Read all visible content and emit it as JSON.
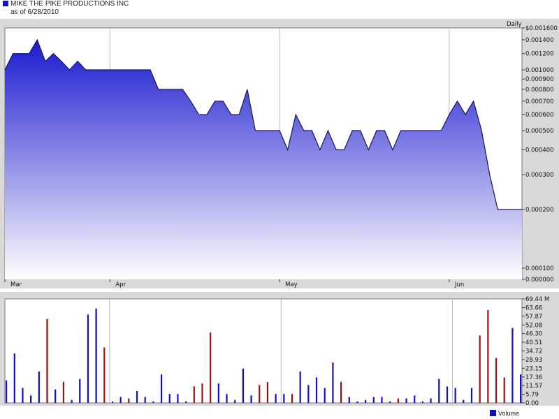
{
  "header": {
    "title": "MIKE THE PIKE PRODUCTIONS INC",
    "subtitle": "as of 6/28/2010"
  },
  "colors": {
    "accent": "#1010c8",
    "price_line": "#1a1a40",
    "fill_top": "#1a1ad0",
    "fill_bottom": "#ffffff",
    "up_bar": "#1010c8",
    "down_bar": "#a01010",
    "panel_bg": "#d9d9d9"
  },
  "chart_data": [
    {
      "type": "area",
      "period_label": "Daily",
      "y_scale": "log",
      "ylim": [
        0.0,
        0.0016
      ],
      "y_ticks": [
        {
          "value": 0.0016,
          "label": "$0.001600"
        },
        {
          "value": 0.0014,
          "label": "0.001400"
        },
        {
          "value": 0.0012,
          "label": "0.001200"
        },
        {
          "value": 0.001,
          "label": "0.001000"
        },
        {
          "value": 0.0009,
          "label": "0.000900"
        },
        {
          "value": 0.0008,
          "label": "0.000800"
        },
        {
          "value": 0.0007,
          "label": "0.000700"
        },
        {
          "value": 0.0006,
          "label": "0.000600"
        },
        {
          "value": 0.0005,
          "label": "0.000500"
        },
        {
          "value": 0.0004,
          "label": "0.000400"
        },
        {
          "value": 0.0003,
          "label": "0.000300"
        },
        {
          "value": 0.0002,
          "label": "0.000200"
        },
        {
          "value": 0.0001,
          "label": "0.000100"
        },
        {
          "value": 0.0,
          "label": "0.000000"
        }
      ],
      "x_labels": [
        "Mar",
        "Apr",
        "May",
        "Jun"
      ],
      "month_start_index": [
        0,
        13,
        34,
        55
      ],
      "values": [
        0.001,
        0.0012,
        0.0012,
        0.0012,
        0.0014,
        0.0011,
        0.0012,
        0.0011,
        0.001,
        0.0011,
        0.001,
        0.001,
        0.001,
        0.001,
        0.001,
        0.001,
        0.001,
        0.001,
        0.001,
        0.0008,
        0.0008,
        0.0008,
        0.0008,
        0.0007,
        0.0006,
        0.0006,
        0.0007,
        0.0007,
        0.0006,
        0.0006,
        0.0008,
        0.0005,
        0.0005,
        0.0005,
        0.0005,
        0.0004,
        0.0006,
        0.0005,
        0.0005,
        0.0004,
        0.0005,
        0.0004,
        0.0004,
        0.0005,
        0.0005,
        0.0004,
        0.0005,
        0.0005,
        0.0004,
        0.0005,
        0.0005,
        0.0005,
        0.0005,
        0.0005,
        0.0005,
        0.0006,
        0.0007,
        0.0006,
        0.0007,
        0.0005,
        0.0003,
        0.0002,
        0.0002,
        0.0002,
        0.0002
      ]
    },
    {
      "type": "bar",
      "series_name": "Volume",
      "unit": "M",
      "ylim": [
        0,
        69.44
      ],
      "y_tick_labels": [
        "69.44 M",
        "63.66",
        "57.87",
        "52.08",
        "46.30",
        "40.51",
        "34.72",
        "28.93",
        "23.15",
        "17.36",
        "11.57",
        "5.79",
        "0.00"
      ],
      "values": [
        15,
        33,
        10,
        5,
        21,
        56,
        9,
        14,
        2,
        16,
        59,
        63,
        37,
        1,
        4,
        3,
        8,
        4,
        1,
        19,
        6,
        6,
        1,
        11,
        13,
        47,
        13,
        6,
        2,
        23,
        5,
        12,
        14,
        6,
        6,
        6,
        21,
        12,
        17,
        10,
        27,
        14,
        4,
        1,
        2,
        4,
        4,
        1,
        3,
        3,
        5,
        1,
        3,
        16,
        11,
        10,
        2,
        10,
        45,
        62,
        30,
        17,
        50,
        19
      ],
      "up_down": [
        "u",
        "u",
        "u",
        "u",
        "u",
        "d",
        "u",
        "d",
        "u",
        "u",
        "u",
        "u",
        "d",
        "u",
        "u",
        "d",
        "u",
        "u",
        "u",
        "u",
        "u",
        "u",
        "u",
        "d",
        "d",
        "d",
        "u",
        "u",
        "u",
        "u",
        "u",
        "d",
        "d",
        "u",
        "u",
        "d",
        "u",
        "u",
        "u",
        "u",
        "u",
        "d",
        "u",
        "u",
        "u",
        "u",
        "u",
        "u",
        "d",
        "u",
        "u",
        "u",
        "u",
        "u",
        "u",
        "u",
        "u",
        "u",
        "d",
        "d",
        "d",
        "d",
        "u",
        "u"
      ]
    }
  ],
  "legend": {
    "label": "Volume"
  }
}
